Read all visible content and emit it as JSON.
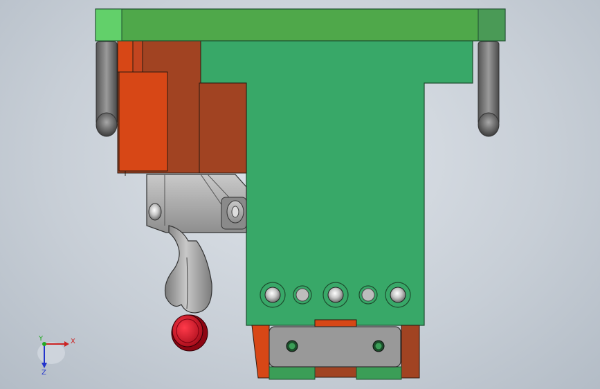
{
  "viewport": {
    "background_top": "#dfe4ea",
    "background_bottom": "#b3bcc6"
  },
  "model": {
    "colors": {
      "top_plate": "#4fa84a",
      "top_plate_light": "#62d06a",
      "main_body": "#38a868",
      "pin": "#6c6c6c",
      "block_orange": "#d74716",
      "block_rust": "#a14322",
      "clamp_gray": "#a9a9a9",
      "handle_red": "#d6112b",
      "bottom_plate": "#999999",
      "bottom_green": "#3b9e57"
    }
  },
  "triad": {
    "x_label": "X",
    "y_label": "Y",
    "z_label": "Z",
    "x_color": "#cc2222",
    "y_color": "#22aa22",
    "z_color": "#2233cc"
  }
}
